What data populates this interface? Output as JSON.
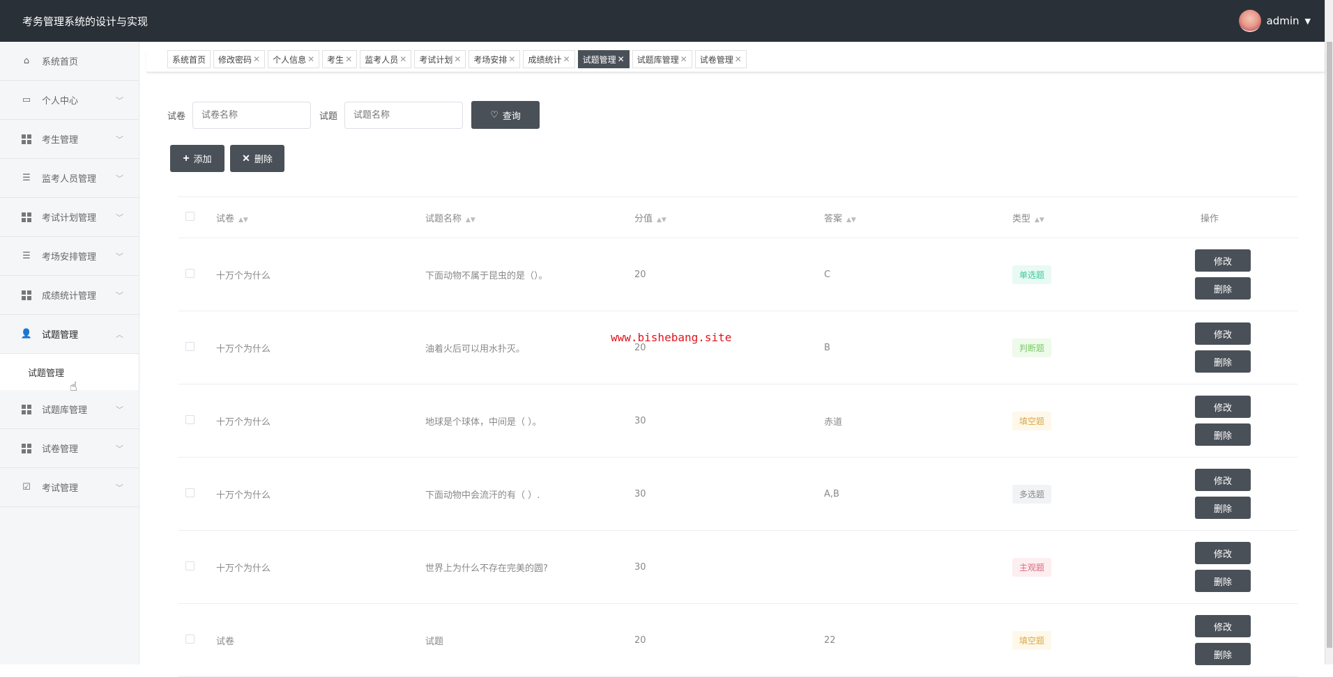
{
  "header": {
    "title": "考务管理系统的设计与实现",
    "user": "admin"
  },
  "sidebar": {
    "items": [
      {
        "label": "系统首页",
        "icon": "home-icon",
        "expandable": false
      },
      {
        "label": "个人中心",
        "icon": "card-icon",
        "expandable": true
      },
      {
        "label": "考生管理",
        "icon": "grid-icon",
        "expandable": true
      },
      {
        "label": "监考人员管理",
        "icon": "list-icon",
        "expandable": true
      },
      {
        "label": "考试计划管理",
        "icon": "grid-icon",
        "expandable": true
      },
      {
        "label": "考场安排管理",
        "icon": "list-icon",
        "expandable": true
      },
      {
        "label": "成绩统计管理",
        "icon": "grid-icon",
        "expandable": true
      },
      {
        "label": "试题管理",
        "icon": "user-icon",
        "expandable": true,
        "expanded": true
      },
      {
        "label": "试题库管理",
        "icon": "grid-icon",
        "expandable": true
      },
      {
        "label": "试卷管理",
        "icon": "grid-icon",
        "expandable": true
      },
      {
        "label": "考试管理",
        "icon": "clipboard-icon",
        "expandable": true
      }
    ],
    "sub_item": "试题管理"
  },
  "tabs": [
    "系统首页",
    "修改密码",
    "个人信息",
    "考生",
    "监考人员",
    "考试计划",
    "考场安排",
    "成绩统计",
    "试题管理",
    "试题库管理",
    "试卷管理"
  ],
  "active_tab": "试题管理",
  "search": {
    "paper_label": "试卷",
    "paper_placeholder": "试卷名称",
    "question_label": "试题",
    "question_placeholder": "试题名称",
    "query_button": "查询"
  },
  "actions": {
    "add": "添加",
    "delete": "删除"
  },
  "table": {
    "columns": [
      "试卷",
      "试题名称",
      "分值",
      "答案",
      "类型",
      "操作"
    ],
    "edit_label": "修改",
    "delete_label": "删除",
    "rows": [
      {
        "paper": "十万个为什么",
        "question": "下面动物不属于昆虫的是（）。",
        "score": "20",
        "answer": "C",
        "type": "单选题"
      },
      {
        "paper": "十万个为什么",
        "question": "油着火后可以用水扑灭。",
        "score": "20",
        "answer": "B",
        "type": "判断题"
      },
      {
        "paper": "十万个为什么",
        "question": "地球是个球体，中间是（ ）。",
        "score": "30",
        "answer": "赤道",
        "type": "填空题"
      },
      {
        "paper": "十万个为什么",
        "question": "下面动物中会流汗的有（ ）.",
        "score": "30",
        "answer": "A,B",
        "type": "多选题"
      },
      {
        "paper": "十万个为什么",
        "question": "世界上为什么不存在完美的圆?",
        "score": "30",
        "answer": "",
        "type": "主观题"
      },
      {
        "paper": "试卷",
        "question": "试题",
        "score": "20",
        "answer": "22",
        "type": "填空题"
      }
    ]
  },
  "tag_colors": {
    "单选题": [
      "#e8faf3",
      "#3cc99a"
    ],
    "判断题": [
      "#eefaea",
      "#7cc96a"
    ],
    "填空题": [
      "#fdf8ea",
      "#d9a84a"
    ],
    "多选题": [
      "#f2f3f5",
      "#888888"
    ],
    "主观题": [
      "#fdeef0",
      "#d96a80"
    ]
  },
  "watermark": "www.bishebang.site"
}
